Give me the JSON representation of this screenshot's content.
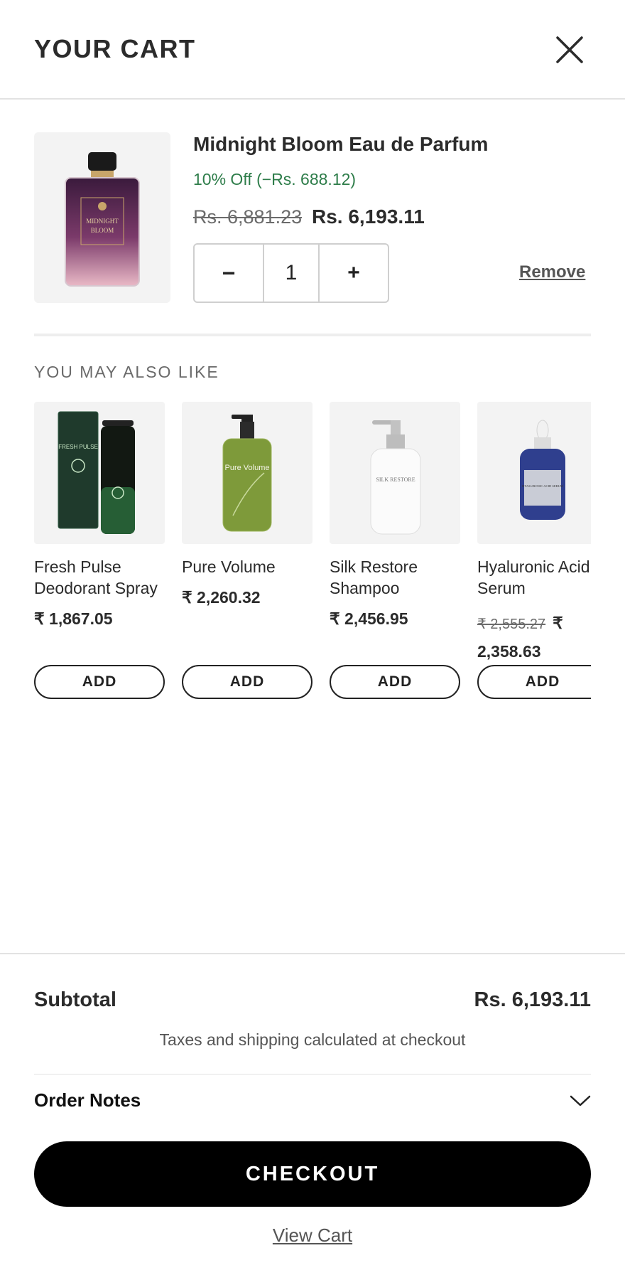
{
  "header": {
    "title": "YOUR CART"
  },
  "cart_item": {
    "name": "Midnight Bloom Eau de Parfum",
    "discount": "10% Off (−Rs. 688.12)",
    "price_original": "Rs. 6,881.23",
    "price_current": "Rs. 6,193.11",
    "quantity": "1",
    "minus_label": "−",
    "plus_label": "+",
    "remove_label": "Remove",
    "image_label_line1": "MIDNIGHT",
    "image_label_line2": "BLOOM"
  },
  "recommendations": {
    "heading": "YOU MAY ALSO LIKE",
    "add_label": "ADD",
    "items": [
      {
        "name": "Fresh Pulse Deodorant Spray",
        "price": "₹ 1,867.05",
        "image_text": "FRESH PULSE"
      },
      {
        "name": "Pure Volume",
        "price": "₹ 2,260.32",
        "image_text": "Pure Volume"
      },
      {
        "name": "Silk Restore Shampoo",
        "price": "₹ 2,456.95",
        "image_text": "SILK RESTORE"
      },
      {
        "name": "Hyaluronic Acid Serum",
        "price_original": "₹ 2,555.27",
        "price": "₹ 2,358.63",
        "image_text": "HYALURONIC ACID SERUM"
      }
    ]
  },
  "footer": {
    "subtotal_label": "Subtotal",
    "subtotal_value": "Rs. 6,193.11",
    "tax_note": "Taxes and shipping calculated at checkout",
    "order_notes_label": "Order Notes",
    "checkout_label": "CHECKOUT",
    "view_cart_label": "View Cart"
  },
  "colors": {
    "discount": "#2e7d4a",
    "checkout_bg": "#000000",
    "perfume_top": "#3a1a3c",
    "perfume_bottom": "#e9b9c6"
  },
  "icons": {
    "close": "close-icon",
    "order_notes_toggle": "chevron-down-icon"
  }
}
